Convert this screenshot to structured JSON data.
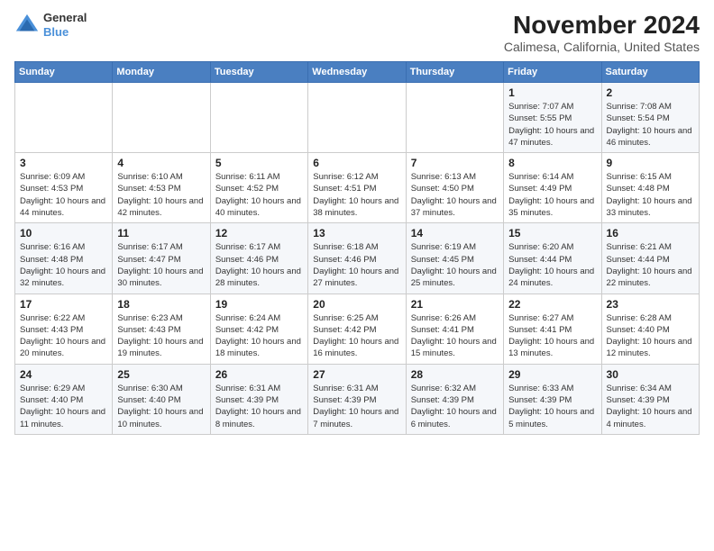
{
  "header": {
    "logo_general": "General",
    "logo_blue": "Blue",
    "title": "November 2024",
    "subtitle": "Calimesa, California, United States"
  },
  "days_of_week": [
    "Sunday",
    "Monday",
    "Tuesday",
    "Wednesday",
    "Thursday",
    "Friday",
    "Saturday"
  ],
  "weeks": [
    [
      {
        "day": "",
        "info": ""
      },
      {
        "day": "",
        "info": ""
      },
      {
        "day": "",
        "info": ""
      },
      {
        "day": "",
        "info": ""
      },
      {
        "day": "",
        "info": ""
      },
      {
        "day": "1",
        "info": "Sunrise: 7:07 AM\nSunset: 5:55 PM\nDaylight: 10 hours and 47 minutes."
      },
      {
        "day": "2",
        "info": "Sunrise: 7:08 AM\nSunset: 5:54 PM\nDaylight: 10 hours and 46 minutes."
      }
    ],
    [
      {
        "day": "3",
        "info": "Sunrise: 6:09 AM\nSunset: 4:53 PM\nDaylight: 10 hours and 44 minutes."
      },
      {
        "day": "4",
        "info": "Sunrise: 6:10 AM\nSunset: 4:53 PM\nDaylight: 10 hours and 42 minutes."
      },
      {
        "day": "5",
        "info": "Sunrise: 6:11 AM\nSunset: 4:52 PM\nDaylight: 10 hours and 40 minutes."
      },
      {
        "day": "6",
        "info": "Sunrise: 6:12 AM\nSunset: 4:51 PM\nDaylight: 10 hours and 38 minutes."
      },
      {
        "day": "7",
        "info": "Sunrise: 6:13 AM\nSunset: 4:50 PM\nDaylight: 10 hours and 37 minutes."
      },
      {
        "day": "8",
        "info": "Sunrise: 6:14 AM\nSunset: 4:49 PM\nDaylight: 10 hours and 35 minutes."
      },
      {
        "day": "9",
        "info": "Sunrise: 6:15 AM\nSunset: 4:48 PM\nDaylight: 10 hours and 33 minutes."
      }
    ],
    [
      {
        "day": "10",
        "info": "Sunrise: 6:16 AM\nSunset: 4:48 PM\nDaylight: 10 hours and 32 minutes."
      },
      {
        "day": "11",
        "info": "Sunrise: 6:17 AM\nSunset: 4:47 PM\nDaylight: 10 hours and 30 minutes."
      },
      {
        "day": "12",
        "info": "Sunrise: 6:17 AM\nSunset: 4:46 PM\nDaylight: 10 hours and 28 minutes."
      },
      {
        "day": "13",
        "info": "Sunrise: 6:18 AM\nSunset: 4:46 PM\nDaylight: 10 hours and 27 minutes."
      },
      {
        "day": "14",
        "info": "Sunrise: 6:19 AM\nSunset: 4:45 PM\nDaylight: 10 hours and 25 minutes."
      },
      {
        "day": "15",
        "info": "Sunrise: 6:20 AM\nSunset: 4:44 PM\nDaylight: 10 hours and 24 minutes."
      },
      {
        "day": "16",
        "info": "Sunrise: 6:21 AM\nSunset: 4:44 PM\nDaylight: 10 hours and 22 minutes."
      }
    ],
    [
      {
        "day": "17",
        "info": "Sunrise: 6:22 AM\nSunset: 4:43 PM\nDaylight: 10 hours and 20 minutes."
      },
      {
        "day": "18",
        "info": "Sunrise: 6:23 AM\nSunset: 4:43 PM\nDaylight: 10 hours and 19 minutes."
      },
      {
        "day": "19",
        "info": "Sunrise: 6:24 AM\nSunset: 4:42 PM\nDaylight: 10 hours and 18 minutes."
      },
      {
        "day": "20",
        "info": "Sunrise: 6:25 AM\nSunset: 4:42 PM\nDaylight: 10 hours and 16 minutes."
      },
      {
        "day": "21",
        "info": "Sunrise: 6:26 AM\nSunset: 4:41 PM\nDaylight: 10 hours and 15 minutes."
      },
      {
        "day": "22",
        "info": "Sunrise: 6:27 AM\nSunset: 4:41 PM\nDaylight: 10 hours and 13 minutes."
      },
      {
        "day": "23",
        "info": "Sunrise: 6:28 AM\nSunset: 4:40 PM\nDaylight: 10 hours and 12 minutes."
      }
    ],
    [
      {
        "day": "24",
        "info": "Sunrise: 6:29 AM\nSunset: 4:40 PM\nDaylight: 10 hours and 11 minutes."
      },
      {
        "day": "25",
        "info": "Sunrise: 6:30 AM\nSunset: 4:40 PM\nDaylight: 10 hours and 10 minutes."
      },
      {
        "day": "26",
        "info": "Sunrise: 6:31 AM\nSunset: 4:39 PM\nDaylight: 10 hours and 8 minutes."
      },
      {
        "day": "27",
        "info": "Sunrise: 6:31 AM\nSunset: 4:39 PM\nDaylight: 10 hours and 7 minutes."
      },
      {
        "day": "28",
        "info": "Sunrise: 6:32 AM\nSunset: 4:39 PM\nDaylight: 10 hours and 6 minutes."
      },
      {
        "day": "29",
        "info": "Sunrise: 6:33 AM\nSunset: 4:39 PM\nDaylight: 10 hours and 5 minutes."
      },
      {
        "day": "30",
        "info": "Sunrise: 6:34 AM\nSunset: 4:39 PM\nDaylight: 10 hours and 4 minutes."
      }
    ]
  ]
}
